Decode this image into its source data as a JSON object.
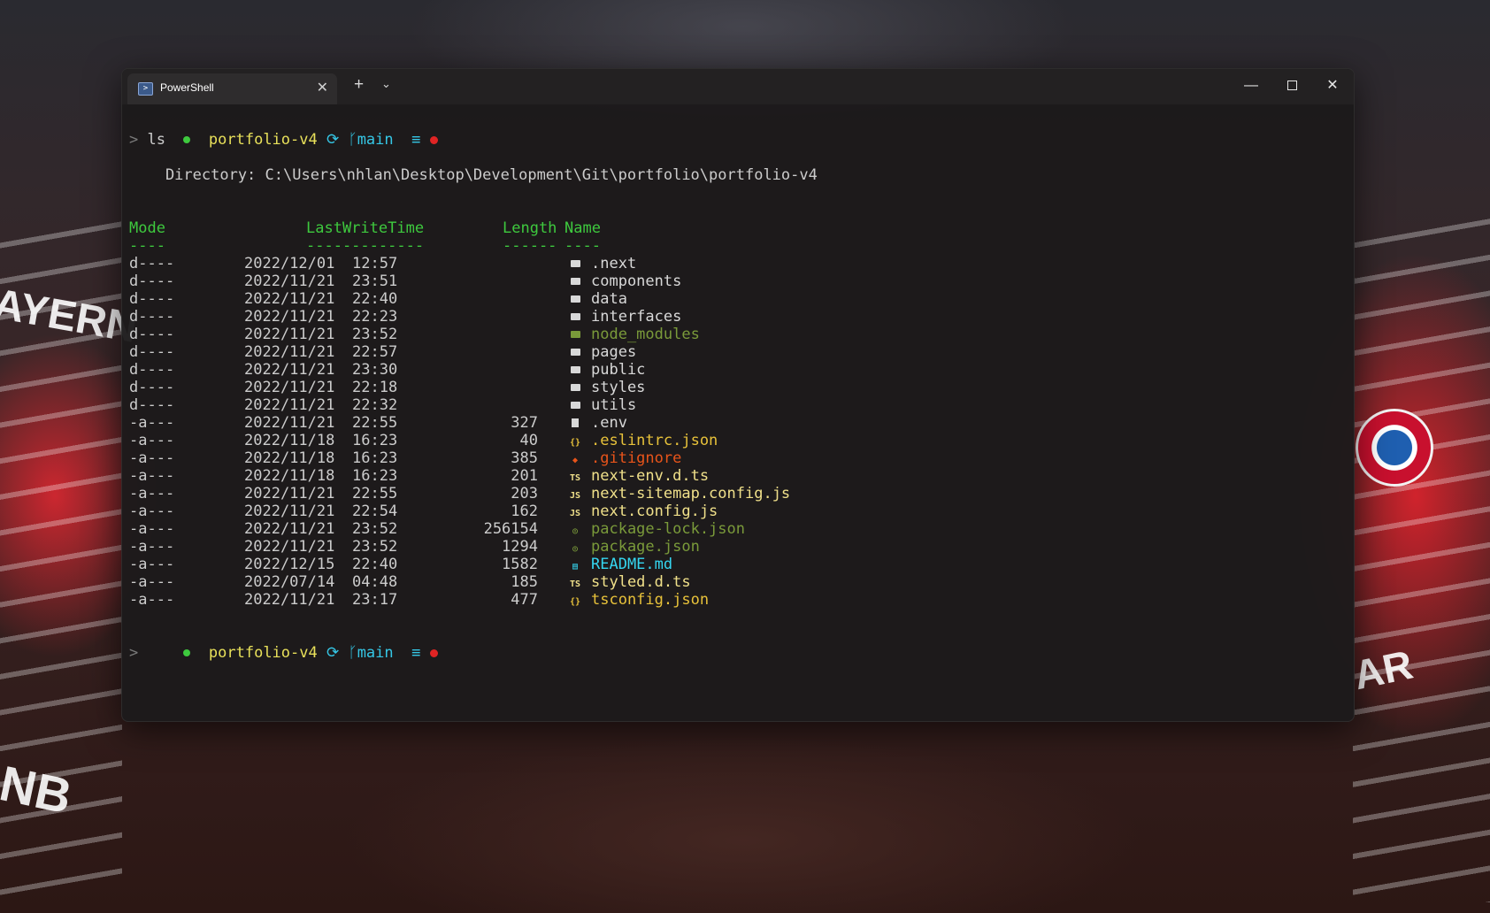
{
  "window": {
    "tab_title": "PowerShell",
    "tab_close": "✕",
    "new_tab": "+",
    "dropdown": "⌄",
    "minimize": "—",
    "close": "✕"
  },
  "prompt": {
    "dir": "portfolio-v4",
    "branch": "main",
    "status": "≡",
    "caret": ">"
  },
  "command": "ls",
  "directory_line": "    Directory: C:\\Users\\nhlan\\Desktop\\Development\\Git\\portfolio\\portfolio-v4",
  "headers": {
    "mode": "Mode",
    "lastwrite": "LastWriteTime",
    "length": "Length",
    "name": "Name",
    "mode_ul": "----",
    "lastwrite_ul": "-------------",
    "length_ul": "------",
    "name_ul": "----"
  },
  "entries": [
    {
      "mode": "d----",
      "date": "2022/12/01",
      "time": "12:57",
      "length": "",
      "name": ".next",
      "kind": "folder",
      "color": "#d8d8d8"
    },
    {
      "mode": "d----",
      "date": "2022/11/21",
      "time": "23:51",
      "length": "",
      "name": "components",
      "kind": "folder",
      "color": "#d8d8d8"
    },
    {
      "mode": "d----",
      "date": "2022/11/21",
      "time": "22:40",
      "length": "",
      "name": "data",
      "kind": "folder",
      "color": "#d8d8d8"
    },
    {
      "mode": "d----",
      "date": "2022/11/21",
      "time": "22:23",
      "length": "",
      "name": "interfaces",
      "kind": "folder",
      "color": "#d8d8d8"
    },
    {
      "mode": "d----",
      "date": "2022/11/21",
      "time": "23:52",
      "length": "",
      "name": "node_modules",
      "kind": "folder-green",
      "color": "#7a9a3a"
    },
    {
      "mode": "d----",
      "date": "2022/11/21",
      "time": "22:57",
      "length": "",
      "name": "pages",
      "kind": "folder",
      "color": "#d8d8d8"
    },
    {
      "mode": "d----",
      "date": "2022/11/21",
      "time": "23:30",
      "length": "",
      "name": "public",
      "kind": "folder",
      "color": "#d8d8d8"
    },
    {
      "mode": "d----",
      "date": "2022/11/21",
      "time": "22:18",
      "length": "",
      "name": "styles",
      "kind": "folder",
      "color": "#d8d8d8"
    },
    {
      "mode": "d----",
      "date": "2022/11/21",
      "time": "22:32",
      "length": "",
      "name": "utils",
      "kind": "folder",
      "color": "#d8d8d8"
    },
    {
      "mode": "-a---",
      "date": "2022/11/21",
      "time": "22:55",
      "length": "327",
      "name": ".env",
      "kind": "file",
      "color": "#d8d8d8"
    },
    {
      "mode": "-a---",
      "date": "2022/11/18",
      "time": "16:23",
      "length": "40",
      "name": ".eslintrc.json",
      "kind": "json",
      "color": "#e8c23a"
    },
    {
      "mode": "-a---",
      "date": "2022/11/18",
      "time": "16:23",
      "length": "385",
      "name": ".gitignore",
      "kind": "git",
      "color": "#e8541a"
    },
    {
      "mode": "-a---",
      "date": "2022/11/18",
      "time": "16:23",
      "length": "201",
      "name": "next-env.d.ts",
      "kind": "ts",
      "color": "#f0e08a"
    },
    {
      "mode": "-a---",
      "date": "2022/11/21",
      "time": "22:55",
      "length": "203",
      "name": "next-sitemap.config.js",
      "kind": "js",
      "color": "#f0e08a"
    },
    {
      "mode": "-a---",
      "date": "2022/11/21",
      "time": "22:54",
      "length": "162",
      "name": "next.config.js",
      "kind": "js",
      "color": "#f0e08a"
    },
    {
      "mode": "-a---",
      "date": "2022/11/21",
      "time": "23:52",
      "length": "256154",
      "name": "package-lock.json",
      "kind": "npm",
      "color": "#7a9a3a"
    },
    {
      "mode": "-a---",
      "date": "2022/11/21",
      "time": "23:52",
      "length": "1294",
      "name": "package.json",
      "kind": "npm",
      "color": "#7a9a3a"
    },
    {
      "mode": "-a---",
      "date": "2022/12/15",
      "time": "22:40",
      "length": "1582",
      "name": "README.md",
      "kind": "md",
      "color": "#35d6f0"
    },
    {
      "mode": "-a---",
      "date": "2022/07/14",
      "time": "04:48",
      "length": "185",
      "name": "styled.d.ts",
      "kind": "ts",
      "color": "#f0e08a"
    },
    {
      "mode": "-a---",
      "date": "2022/11/21",
      "time": "23:17",
      "length": "477",
      "name": "tsconfig.json",
      "kind": "json",
      "color": "#e8c23a"
    }
  ],
  "icon_glyphs": {
    "json": "{}",
    "git": "◆",
    "ts": "TS",
    "js": "JS",
    "npm": "◎",
    "md": "▤"
  },
  "background_text": {
    "left_word": "AYERN",
    "left_lower": "NB",
    "right_word": "AR"
  }
}
